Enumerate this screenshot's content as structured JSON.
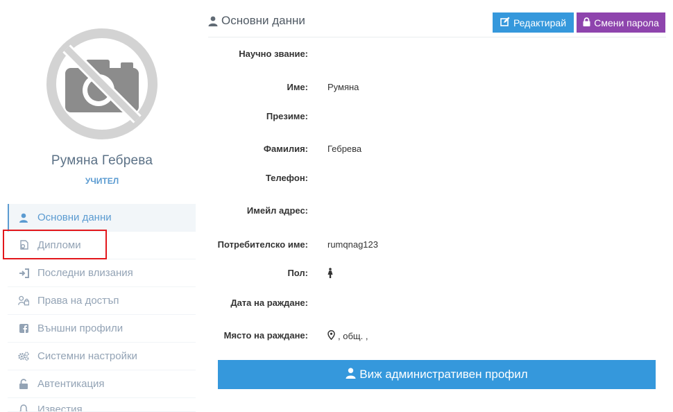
{
  "profile": {
    "name": "Румяна Гебрева",
    "role": "УЧИТЕЛ"
  },
  "sidebar": {
    "items": [
      {
        "label": "Основни данни",
        "icon": "user-icon",
        "active": true
      },
      {
        "label": "Дипломи",
        "icon": "certificate-icon",
        "active": false
      },
      {
        "label": "Последни влизания",
        "icon": "sign-in-icon",
        "active": false
      },
      {
        "label": "Права на достъп",
        "icon": "user-lock-icon",
        "active": false
      },
      {
        "label": "Външни профили",
        "icon": "facebook-icon",
        "active": false
      },
      {
        "label": "Системни настройки",
        "icon": "cogs-icon",
        "active": false
      },
      {
        "label": "Автентикация",
        "icon": "unlock-icon",
        "active": false
      },
      {
        "label": "Известия",
        "icon": "bell-icon",
        "active": false
      }
    ]
  },
  "main": {
    "title": "Основни данни",
    "edit_label": "Редактирай",
    "password_label": "Смени парола",
    "admin_profile_label": "Виж административен профил",
    "fields": [
      {
        "label": "Научно звание:",
        "value": ""
      },
      {
        "label": "Име:",
        "value": "Румяна"
      },
      {
        "label": "Презиме:",
        "value": ""
      },
      {
        "label": "Фамилия:",
        "value": "Гебрева"
      },
      {
        "label": "Телефон:",
        "value": ""
      },
      {
        "label": "Имейл адрес:",
        "value": ""
      },
      {
        "label": "Потребителско име:",
        "value": "rumqnag123"
      },
      {
        "label": "Пол:",
        "value": ""
      },
      {
        "label": "Дата на раждане:",
        "value": ""
      },
      {
        "label": "Място на раждане:",
        "value": ", общ. ,"
      }
    ]
  },
  "colors": {
    "accent": "#3598dc",
    "purple": "#8e44ad",
    "nav_text": "#93a3b5",
    "highlight": "#e3161b"
  }
}
